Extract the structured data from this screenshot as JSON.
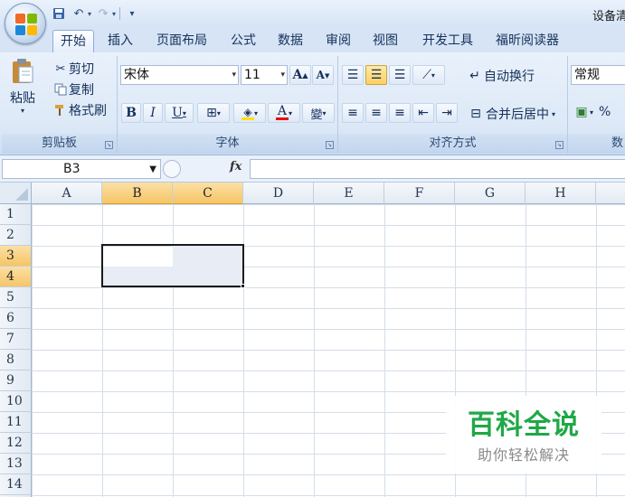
{
  "window": {
    "title": "设备清"
  },
  "quick_access": {
    "save_icon": "save-icon",
    "undo_icon": "undo-icon",
    "redo_icon": "redo-icon"
  },
  "tabs": [
    {
      "label": "开始",
      "active": true
    },
    {
      "label": "插入"
    },
    {
      "label": "页面布局"
    },
    {
      "label": "公式"
    },
    {
      "label": "数据"
    },
    {
      "label": "审阅"
    },
    {
      "label": "视图"
    },
    {
      "label": "开发工具"
    },
    {
      "label": "福昕阅读器"
    }
  ],
  "clipboard": {
    "group_label": "剪贴板",
    "paste_label": "粘贴",
    "cut_label": "剪切",
    "copy_label": "复制",
    "format_painter_label": "格式刷"
  },
  "font": {
    "group_label": "字体",
    "font_name": "宋体",
    "font_size": "11",
    "grow_label": "A",
    "shrink_label": "A",
    "bold_label": "B",
    "italic_label": "I",
    "underline_label": "U",
    "phonetic_label": "變",
    "font_color_label": "A",
    "font_color": "#e81010",
    "fill_color": "#ffe000"
  },
  "alignment": {
    "group_label": "对齐方式",
    "wrap_text_label": "自动换行",
    "merge_center_label": "合并后居中"
  },
  "number": {
    "group_label": "数",
    "format_value": "常规",
    "percent_label": "%"
  },
  "formula_bar": {
    "name_box": "B3",
    "fx_label": "fx",
    "content": ""
  },
  "sheet": {
    "columns": [
      "A",
      "B",
      "C",
      "D",
      "E",
      "F",
      "G",
      "H"
    ],
    "rows": [
      "1",
      "2",
      "3",
      "4",
      "5",
      "6",
      "7",
      "8",
      "9",
      "10",
      "11",
      "12",
      "13",
      "14",
      "15"
    ],
    "selected_range": "B3:C4",
    "highlight_color": "#f6c567"
  },
  "watermark": {
    "main": "百科全说",
    "sub": "助你轻松解决",
    "color": "#1fa847"
  }
}
